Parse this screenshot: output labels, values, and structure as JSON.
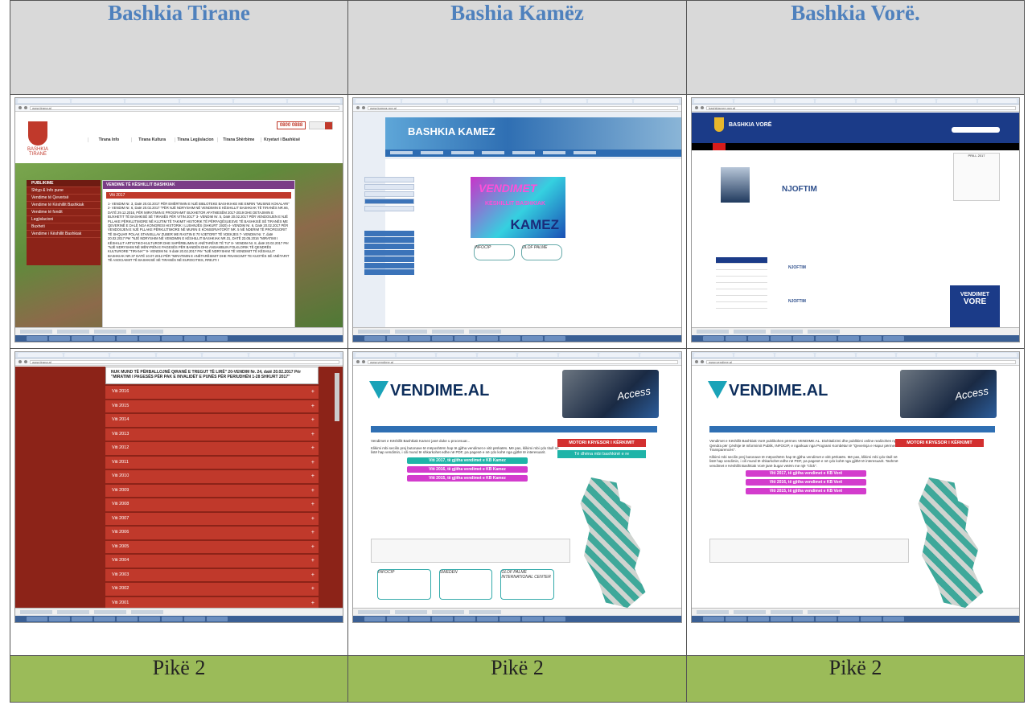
{
  "headers": [
    "Bashkia Tirane",
    "Bashia Kamëz",
    "Bashkia Vorë."
  ],
  "scores": [
    "Pikë 2",
    "Pikë 2",
    "Pikë 2"
  ],
  "screens": {
    "tirane_top": {
      "url": "www.tirana.al",
      "logo": "BASHKIA TIRANE",
      "hotline": "0800 0888",
      "menu": [
        "Tirana Info",
        "Tirana Kultura",
        "Tirana Legjislacion",
        "Tirana Shërbime",
        "Kryetari i Bashkisë"
      ],
      "left_panel_title": "PUBLIKIME",
      "left_panel_items": [
        "Shtyp & Info pune",
        "Vendime të Qeverisë",
        "Vendime të Këshillit Bashkiak",
        "Vendime të fondit",
        "Legjislacioni",
        "Buxheti",
        "Vendime i Këshillit Bashkiak"
      ],
      "panel_title": "VENDIME TË KËSHILLIT BASHKIAK",
      "year": "Viti 2017",
      "panel_text": "1- VENDIM Nr. 3, Datë 20.02.2017 PËR EMËRTIMIN E NJË BIBLOTEKE BASHKIAKE ME EMRIN \"MUSINE KOKALARI\" 2- VENDIM Nr. 6, Datë 20.02.2017 \"PËR NJË NDRYSHIM NË VENDIMIN E KËSHILLIT BASHKIAK TË TIRANËS NR.66, DATË 29.12.2016, PËR MIRATIMIN E PROGRAMIT BUXHETOR AFATMESËM 2017-2019 DHE DETAJIMIN E BUXHETIT TË BASHKISË SË TIRANËS PËR VITIN 2017\" 3- VENDIM Nr. 5, Datë 20.02.2017 PËR VENDOSJEN E NJË PLLAKE PËRKUJTIMORE NË KUJTIM TË TAKIMIT HISTORIK TË PËRFAQËSUESVE TË BASHKISË SË TIRANËS ME QEVERINË E DALË NGA KONGRESI HISTORIK I LUSHNJËS (SHKURT 1920) 4- VENDIM Nr. 6, Datë 20.02.2017 PËR VENDOSJEN E NJË PLLAKE PËRKUJTIMORE NË MURIN E KONSERVATORIT NR. 5 NË NDERIM TË PROFESORIT TË SHQUAR POLAK STANISLLAV ZUBER ME RASTIN E 70 VJETORIT TË VDEKJES 7- VENDIM Nr. 7, datë 20.02.2017 Për \"NJË NDRYSHIM NË VENDIMIN E KËSHILLIT BASHKIAK NR.31, DATË 23.05.2016 \"MIRATIMI I KËSHILLIT ARTISTIKO-KULTUROR DHE SHPËRBLIMIN E ANËTARËVE TË TIJ\" 8- VENDIM Nr. 8, datë 20.02.2017 Për \"NJË NDRYSHIM NË MËNYRËN E PAGESËS PËR BANDËN DHE ANSAMBLIN FOLKLORIK TË QENDRËS KULTURORE \"TIRANA\"\" 9- VENDIM Nr. 9 datë 20.02.2017 Për \"NJË NDRYSHIM TË VENDIMIT TË KËSHILLIT BASHKIAK NR.37 DATË 10.07.2012 PËR \"MIRATIMIN E ANËTARËSIMIT DHE FINANCIMIT TE KUOTËS SË ANËTARIT TË ASOCIAIMIT TË BASHKISË SË TIRANËS NË EUROCITIES, RREJTI I"
    },
    "tirane_years": {
      "url": "www.tirana.al",
      "box_text": "NUK MUND TË PËRBALLOJNË QIRANË E TREGUT TË LIRË\" 20-VENDIM Nr. 24, datë 20.02.2017 Për \"MIRATIMI I PAGESËS PËR PAK E INVALIDËT E PUNËS PËR PERIUDHËN 1-28 SHKURT 2017\"",
      "years": [
        "Viti 2016",
        "Viti 2015",
        "Viti 2014",
        "Viti 2013",
        "Viti 2012",
        "Viti 2011",
        "Viti 2010",
        "Viti 2009",
        "Viti 2008",
        "Viti 2007",
        "Viti 2006",
        "Viti 2005",
        "Viti 2004",
        "Viti 2003",
        "Viti 2002",
        "Viti 2001"
      ]
    },
    "kamez": {
      "url": "www.kamza.gov.al",
      "banner": "BASHKIA KAMEZ",
      "vend_a": "VENDIMET",
      "vend_b": "KËSHILLIT BASHKIAK",
      "vend_c": "KAMEZ",
      "logo_1": "INFOCIP",
      "logo_2": "OLOF PALME"
    },
    "kamez_vendime": {
      "url": "www.vendime.al",
      "logo": "VENDIME.AL",
      "key": "Access",
      "text_1": "Vendimet e Këshillit Bashkiak Kamez janë duke u procesuar...",
      "text_2": "Klikimi mbi secilin prej butonave të mëposhtëm hap të gjitha vendimet e vitit përkatës. Më pas, klikimi mbi çdo titull në listë hap vendimin, i cili mund të shkarkohet edhe në PDF, pa pagesë e në çdo kohë nga gjithë të interesuarit.",
      "buttons": [
        "Viti 2017, të gjitha vendimet e KB Kamez",
        "Viti 2016, të gjitha vendimet e KB Kamez",
        "Viti 2015, të gjitha vendimet e KB Kamez"
      ],
      "red_button": "MOTORI KRYESOR I KËRKIMIT",
      "teal_button": "Të dhëna mbi bashkinë e re",
      "logo_1": "INFOCIP",
      "logo_2": "SWEDEN",
      "logo_3": "OLOF PALME INTERNATIONAL CENTER"
    },
    "vore": {
      "url": "bashkiavore.gov.al",
      "title": "BASHKIA VORË",
      "njoftim": "NJOFTIM",
      "njoftim_small": "NJOFTIM",
      "cal_month": "PRILL 2017",
      "vendimet": "VENDIMET",
      "vore_word": "VORE"
    },
    "vore_vendime": {
      "url": "www.vendime.al",
      "logo": "VENDIME.AL",
      "key": "Access",
      "text_1": "Vendimet e Këshillit Bashkiak Vorë publikohen përmes VENDIME.AL. Dixhitalizimi dhe publikimi online realizohen nga Qendra për Çështje të Informimit Publik, INFOCIP, e ngarkuar nga Programi Kombëtar të \"Qeverisja e Hapur përmes Transparencës\".",
      "text_2": "Klikimi mbi secilin prej butonave të mëposhtëm hap të gjitha vendimet e vitit përkatës. Më pas, klikimi mbi çdo titull në listë hap vendimin, i cili mund të shkarkohet edhe në PDF, pa pagesë e në çdo kohë nga gjithë të interesuarit. Tashmë vendimet e Këshillit Bashkiak Vorë janë bugar vetëm me një \"click\".",
      "buttons": [
        "Viti 2017, të gjitha vendimet e KB Vorë",
        "Viti 2016, të gjitha vendimet e KB Vorë",
        "Viti 2015, të gjitha vendimet e KB Vorë"
      ],
      "red_button": "MOTORI KRYESOR I KËRKIMIT"
    }
  }
}
